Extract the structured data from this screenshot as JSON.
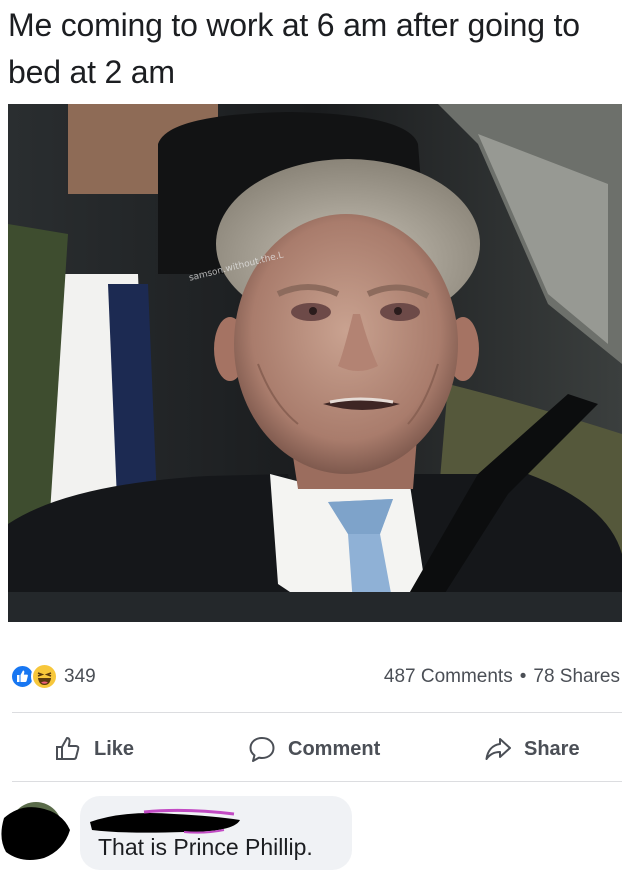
{
  "caption": "Me coming to work at 6 am after going to bed at 2 am",
  "photo": {
    "watermark": "samson.without.the.L"
  },
  "reactions": {
    "icons": [
      "like-icon",
      "haha-icon"
    ],
    "count": "349"
  },
  "stats": {
    "comments": "487 Comments",
    "separator": "•",
    "shares": "78 Shares"
  },
  "actions": {
    "like": "Like",
    "comment": "Comment",
    "share": "Share"
  },
  "comment": {
    "text": "That is Prince Phillip."
  },
  "colors": {
    "like_blue": "#1877f2",
    "haha_yellow": "#f7c73b",
    "secondary_text": "#4b4f56",
    "bubble_bg": "#f0f2f5"
  }
}
